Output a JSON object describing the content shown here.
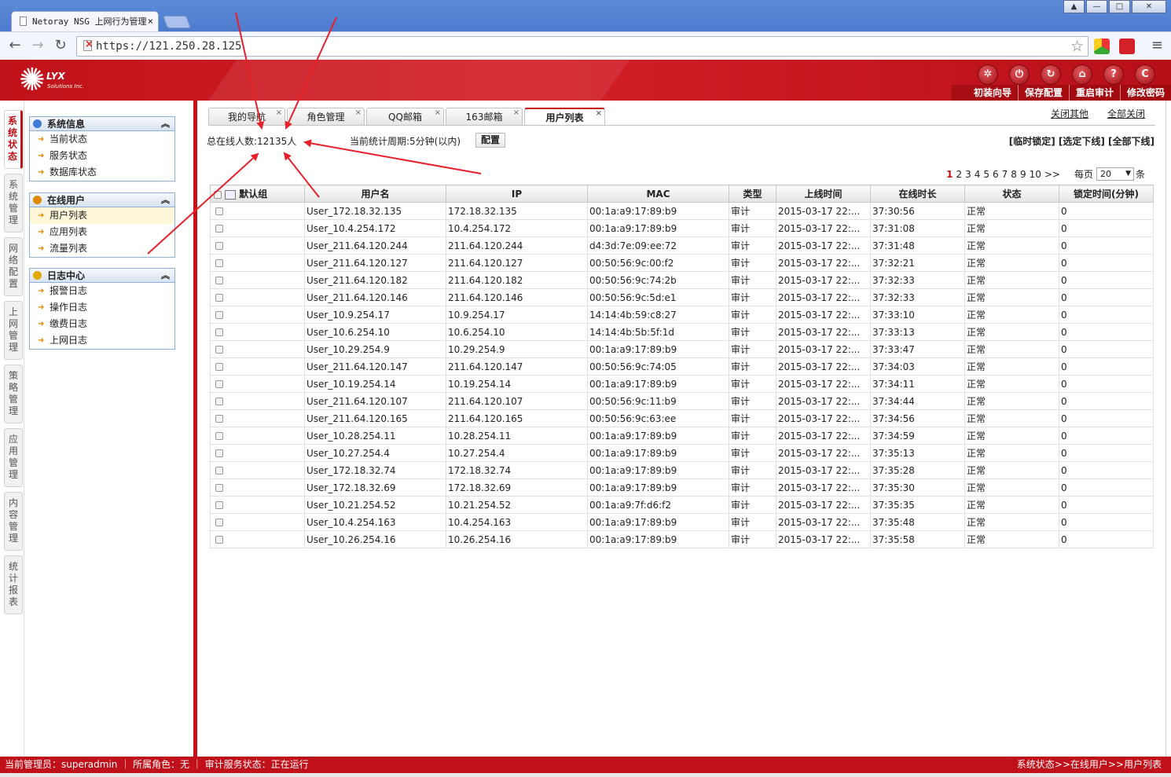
{
  "browser": {
    "tab_title": "Netoray NSG 上网行为管理",
    "tab_close": "×",
    "url": "https://121.250.28.125",
    "back_icon": "←",
    "forward_icon": "→",
    "reload_icon": "↻",
    "star_icon": "☆",
    "menu_icon": "≡",
    "win_user": "▲",
    "win_min": "—",
    "win_max": "□",
    "win_close": "✕"
  },
  "header": {
    "logo_text": "LYX",
    "logo_sub": "Solutions Inc.",
    "icons": [
      "✲",
      "⏻",
      "↻",
      "⌂",
      "?",
      "C"
    ],
    "links": [
      "初装向导",
      "保存配置",
      "重启审计",
      "修改密码"
    ]
  },
  "left_tabs": [
    "系统状态",
    "系统管理",
    "网络配置",
    "上网管理",
    "策略管理",
    "应用管理",
    "内容管理",
    "统计报表"
  ],
  "sidebar": {
    "collapse_icon": "︽",
    "arrow_icon": "➜",
    "sections": [
      {
        "title": "系统信息",
        "items": [
          "当前状态",
          "服务状态",
          "数据库状态"
        ]
      },
      {
        "title": "在线用户",
        "items": [
          "用户列表",
          "应用列表",
          "流量列表"
        ]
      },
      {
        "title": "日志中心",
        "items": [
          "报警日志",
          "操作日志",
          "缴费日志",
          "上网日志"
        ]
      }
    ]
  },
  "main": {
    "tabs": [
      {
        "label": "我的导航",
        "close": "×"
      },
      {
        "label": "角色管理",
        "close": "×"
      },
      {
        "label": "QQ邮箱",
        "close": "×"
      },
      {
        "label": "163邮箱",
        "close": "×"
      },
      {
        "label": "用户列表",
        "close": "×"
      }
    ],
    "close_others": "关闭其他",
    "close_all": "全部关闭",
    "summary": "总在线人数:12135人",
    "period": "当前统计周期:5分钟(以内)",
    "config_button": "配置",
    "actions": "[临时锁定] [选定下线] [全部下线]",
    "pager": {
      "pages": [
        "1",
        "2",
        "3",
        "4",
        "5",
        "6",
        "7",
        "8",
        "9",
        "10",
        ">>"
      ],
      "current": "1",
      "per_page_label": "每页",
      "per_page_value": "20",
      "unit": "条",
      "dropdown_icon": "▼"
    }
  },
  "table": {
    "columns": [
      "默认组",
      "用户名",
      "IP",
      "MAC",
      "类型",
      "上线时间",
      "在线时长",
      "状态",
      "锁定时间(分钟)"
    ],
    "rows": [
      [
        "User_172.18.32.135",
        "172.18.32.135",
        "00:1a:a9:17:89:b9",
        "审计",
        "2015-03-17 22:...",
        "37:30:56",
        "正常",
        "0"
      ],
      [
        "User_10.4.254.172",
        "10.4.254.172",
        "00:1a:a9:17:89:b9",
        "审计",
        "2015-03-17 22:...",
        "37:31:08",
        "正常",
        "0"
      ],
      [
        "User_211.64.120.244",
        "211.64.120.244",
        "d4:3d:7e:09:ee:72",
        "审计",
        "2015-03-17 22:...",
        "37:31:48",
        "正常",
        "0"
      ],
      [
        "User_211.64.120.127",
        "211.64.120.127",
        "00:50:56:9c:00:f2",
        "审计",
        "2015-03-17 22:...",
        "37:32:21",
        "正常",
        "0"
      ],
      [
        "User_211.64.120.182",
        "211.64.120.182",
        "00:50:56:9c:74:2b",
        "审计",
        "2015-03-17 22:...",
        "37:32:33",
        "正常",
        "0"
      ],
      [
        "User_211.64.120.146",
        "211.64.120.146",
        "00:50:56:9c:5d:e1",
        "审计",
        "2015-03-17 22:...",
        "37:32:33",
        "正常",
        "0"
      ],
      [
        "User_10.9.254.17",
        "10.9.254.17",
        "14:14:4b:59:c8:27",
        "审计",
        "2015-03-17 22:...",
        "37:33:10",
        "正常",
        "0"
      ],
      [
        "User_10.6.254.10",
        "10.6.254.10",
        "14:14:4b:5b:5f:1d",
        "审计",
        "2015-03-17 22:...",
        "37:33:13",
        "正常",
        "0"
      ],
      [
        "User_10.29.254.9",
        "10.29.254.9",
        "00:1a:a9:17:89:b9",
        "审计",
        "2015-03-17 22:...",
        "37:33:47",
        "正常",
        "0"
      ],
      [
        "User_211.64.120.147",
        "211.64.120.147",
        "00:50:56:9c:74:05",
        "审计",
        "2015-03-17 22:...",
        "37:34:03",
        "正常",
        "0"
      ],
      [
        "User_10.19.254.14",
        "10.19.254.14",
        "00:1a:a9:17:89:b9",
        "审计",
        "2015-03-17 22:...",
        "37:34:11",
        "正常",
        "0"
      ],
      [
        "User_211.64.120.107",
        "211.64.120.107",
        "00:50:56:9c:11:b9",
        "审计",
        "2015-03-17 22:...",
        "37:34:44",
        "正常",
        "0"
      ],
      [
        "User_211.64.120.165",
        "211.64.120.165",
        "00:50:56:9c:63:ee",
        "审计",
        "2015-03-17 22:...",
        "37:34:56",
        "正常",
        "0"
      ],
      [
        "User_10.28.254.11",
        "10.28.254.11",
        "00:1a:a9:17:89:b9",
        "审计",
        "2015-03-17 22:...",
        "37:34:59",
        "正常",
        "0"
      ],
      [
        "User_10.27.254.4",
        "10.27.254.4",
        "00:1a:a9:17:89:b9",
        "审计",
        "2015-03-17 22:...",
        "37:35:13",
        "正常",
        "0"
      ],
      [
        "User_172.18.32.74",
        "172.18.32.74",
        "00:1a:a9:17:89:b9",
        "审计",
        "2015-03-17 22:...",
        "37:35:28",
        "正常",
        "0"
      ],
      [
        "User_172.18.32.69",
        "172.18.32.69",
        "00:1a:a9:17:89:b9",
        "审计",
        "2015-03-17 22:...",
        "37:35:30",
        "正常",
        "0"
      ],
      [
        "User_10.21.254.52",
        "10.21.254.52",
        "00:1a:a9:7f:d6:f2",
        "审计",
        "2015-03-17 22:...",
        "37:35:35",
        "正常",
        "0"
      ],
      [
        "User_10.4.254.163",
        "10.4.254.163",
        "00:1a:a9:17:89:b9",
        "审计",
        "2015-03-17 22:...",
        "37:35:48",
        "正常",
        "0"
      ],
      [
        "User_10.26.254.16",
        "10.26.254.16",
        "00:1a:a9:17:89:b9",
        "审计",
        "2015-03-17 22:...",
        "37:35:58",
        "正常",
        "0"
      ]
    ]
  },
  "statusbar": {
    "left": "当前管理员：superadmin ｜ 所属角色：无 ｜ 审计服务状态：正在运行",
    "right": "系统状态>>在线用户>>用户列表"
  },
  "colors": {
    "brand_red": "#c0101a",
    "annotation_red": "#e8202a",
    "accent_blue": "#3d7bd6"
  }
}
